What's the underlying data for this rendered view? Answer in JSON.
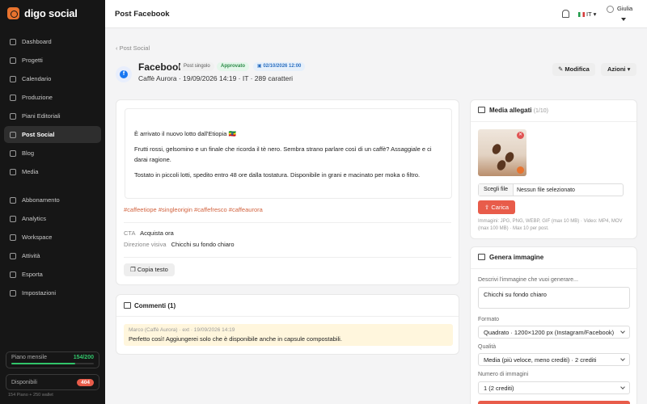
{
  "brand": {
    "name": "digo social",
    "accent": "#e8732e"
  },
  "sidebar": {
    "items": [
      {
        "label": "Dashboard",
        "icon": "dashboard-icon"
      },
      {
        "label": "Progetti",
        "icon": "folder-icon"
      },
      {
        "label": "Calendario",
        "icon": "calendar-icon"
      },
      {
        "label": "Produzione",
        "icon": "production-icon"
      },
      {
        "label": "Piani Editoriali",
        "icon": "plan-icon"
      },
      {
        "label": "Post Social",
        "icon": "post-icon",
        "active": true
      },
      {
        "label": "Blog",
        "icon": "blog-icon"
      },
      {
        "label": "Media",
        "icon": "media-icon"
      },
      {
        "label": "Abbonamento",
        "icon": "subscription-icon"
      },
      {
        "label": "Analytics",
        "icon": "analytics-icon"
      },
      {
        "label": "Workspace",
        "icon": "workspace-icon"
      },
      {
        "label": "Attività",
        "icon": "activity-icon"
      },
      {
        "label": "Esporta",
        "icon": "export-icon"
      },
      {
        "label": "Impostazioni",
        "icon": "settings-icon"
      }
    ],
    "plan": {
      "label": "Piano mensile",
      "count": "154/200",
      "progress": 0.77
    },
    "available": {
      "label": "Disponibili",
      "count": "404"
    },
    "footnote": "154 Piano + 250 wallet"
  },
  "topbar": {
    "title": "Post Facebook",
    "lang": "IT",
    "user": "Giulia"
  },
  "header": {
    "breadcrumb": "Post Social",
    "title": "Facebook",
    "badge_type": "Post singolo",
    "badge_status": "Approvato",
    "badge_date": "02/10/2026 12:00",
    "subtitle": "Caffè Aurora · 19/09/2026 14:19 · IT · 289 caratteri",
    "edit_label": "Modifica",
    "actions_label": "Azioni"
  },
  "post": {
    "p1": "È arrivato il nuovo lotto dall'Etiopia 🇪🇹",
    "p2": "Frutti rossi, gelsomino e un finale che ricorda il tè nero. Sembra strano parlare così di un caffè? Assaggiale e ci darai ragione.",
    "p3": "Tostato in piccoli lotti, spedito entro 48 ore dalla tostatura. Disponibile in grani e macinato per moka o filtro.",
    "hashtags": "#caffeetiope #singleorigin #caffefresco #caffeaurora",
    "cta_label": "CTA",
    "cta_value": "Acquista ora",
    "visual_label": "Direzione visiva",
    "visual_value": "Chicchi su fondo chiaro",
    "copy_label": "Copia testo"
  },
  "comments": {
    "title": "Commenti (1)",
    "items": [
      {
        "meta": "Marco (Caffè Aurora) · ext · 19/09/2026 14:19",
        "text": "Perfetto così! Aggiungerei solo che è disponibile anche in capsule compostabili."
      }
    ]
  },
  "media": {
    "title": "Media allegati",
    "count": "(1/10)",
    "file_button": "Scegli file",
    "file_status": "Nessun file selezionato",
    "upload_label": "Carica",
    "hint": "Immagini: JPG, PNG, WEBP, GIF (max 10 MB) · Video: MP4, MOV (max 100 MB) · Max 10 per post."
  },
  "generate": {
    "title": "Genera immagine",
    "prompt_label": "Descrivi l'immagine che vuoi generare...",
    "prompt_value": "Chicchi su fondo chiaro",
    "format_label": "Formato",
    "format_value": "Quadrato · 1200×1200 px (Instagram/Facebook)",
    "quality_label": "Qualità",
    "quality_value": "Media (più veloce, meno crediti) · 2 crediti",
    "count_label": "Numero di immagini",
    "count_value": "1 (2 crediti)"
  }
}
